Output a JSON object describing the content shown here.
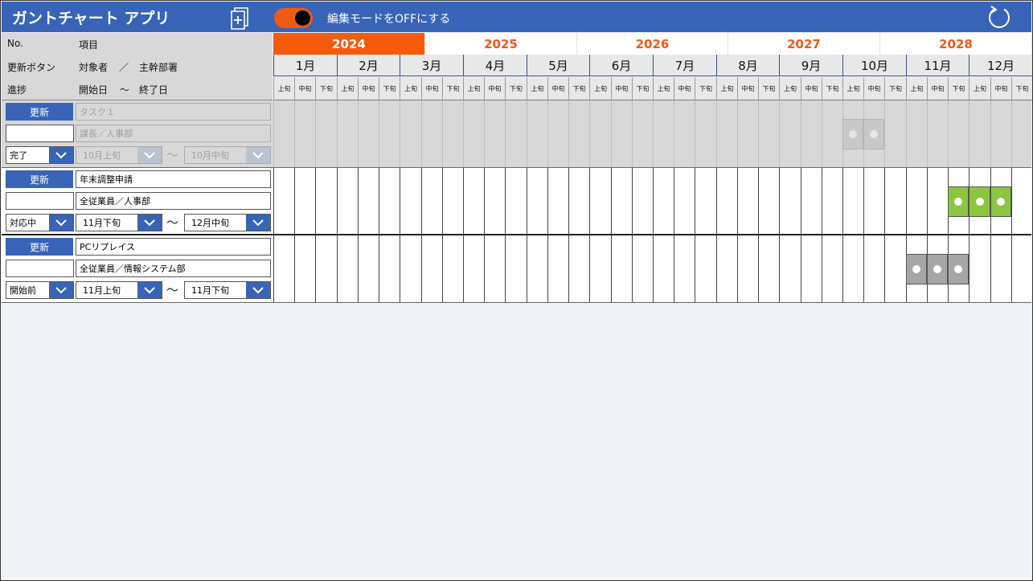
{
  "header": {
    "title": "ガントチャート アプリ",
    "edit_toggle_label": "編集モードをOFFにする",
    "edit_toggle_on": true,
    "accent_color": "#3864b8",
    "toggle_color": "#ef5a14",
    "new_icon": "new-document-icon",
    "refresh_icon": "refresh-icon"
  },
  "left_header": {
    "no_label": "No.",
    "item_label": "項目",
    "update_button_label": "更新ボタン",
    "target_label": "対象者",
    "slash": "／",
    "department_label": "主幹部署",
    "progress_label": "進捗",
    "start_label": "開始日",
    "tilde": "～",
    "end_label": "終了日"
  },
  "years": [
    "2024",
    "2025",
    "2026",
    "2027",
    "2028"
  ],
  "selected_year": "2024",
  "months": [
    "1月",
    "2月",
    "3月",
    "4月",
    "5月",
    "6月",
    "7月",
    "8月",
    "9月",
    "10月",
    "11月",
    "12月"
  ],
  "decades": [
    "上旬",
    "中旬",
    "下旬"
  ],
  "tasks": [
    {
      "update_label": "更新",
      "title": "タスク１",
      "number": "",
      "assignee": "課長／人事部",
      "status": "完了",
      "start": "10月上旬",
      "end": "10月中旬",
      "tilde": "～",
      "state": "completed",
      "bar_color": "#c8c8c8",
      "bar_start_index": 27,
      "bar_length": 2
    },
    {
      "update_label": "更新",
      "title": "年末調整申請",
      "number": "",
      "assignee": "全従業員／人事部",
      "status": "対応中",
      "start": "11月下旬",
      "end": "12月中旬",
      "tilde": "～",
      "state": "in-progress",
      "bar_color": "#8cc63f",
      "bar_start_index": 32,
      "bar_length": 3
    },
    {
      "update_label": "更新",
      "title": "PCリプレイス",
      "number": "",
      "assignee": "全従業員／情報システム部",
      "status": "開始前",
      "start": "11月上旬",
      "end": "11月下旬",
      "tilde": "～",
      "state": "not-started",
      "bar_color": "#a6a6a6",
      "bar_start_index": 30,
      "bar_length": 3
    }
  ]
}
